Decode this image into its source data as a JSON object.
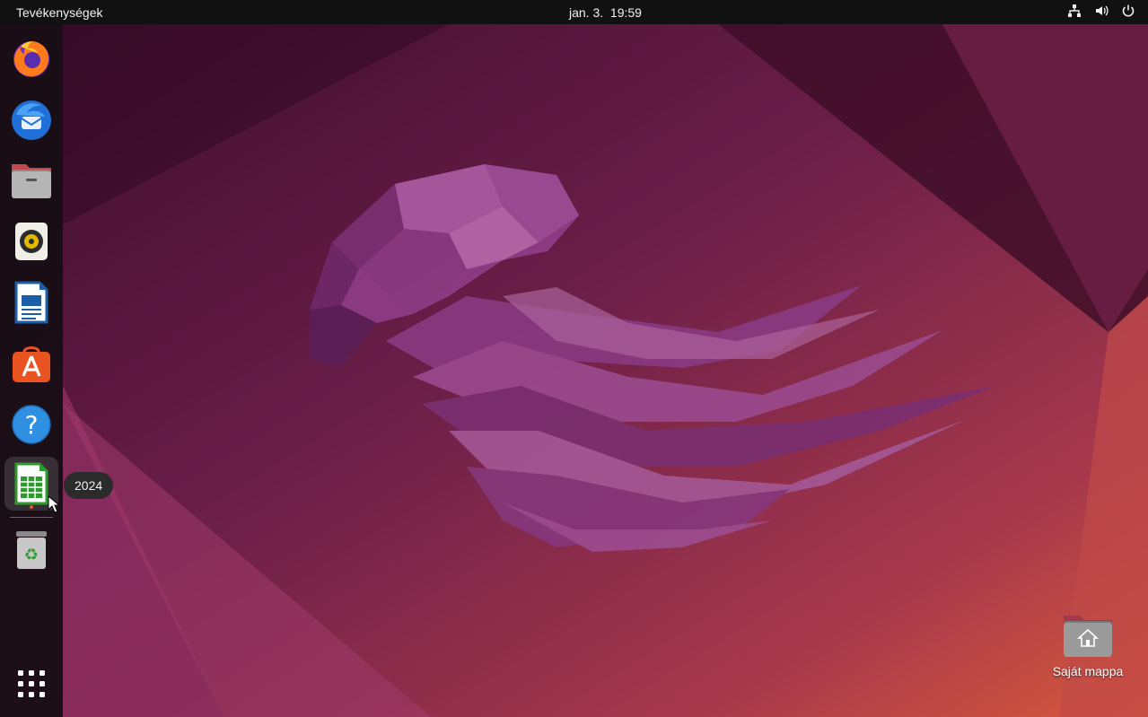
{
  "topbar": {
    "activities_label": "Tevékenységek",
    "clock": "jan. 3.  19:59",
    "tray_icons": [
      "network-icon",
      "volume-icon",
      "power-icon"
    ]
  },
  "dock": {
    "items": [
      {
        "name": "Firefox",
        "icon": "firefox-icon"
      },
      {
        "name": "Thunderbird",
        "icon": "thunderbird-icon"
      },
      {
        "name": "Files",
        "icon": "files-icon"
      },
      {
        "name": "Rhythmbox",
        "icon": "rhythmbox-icon"
      },
      {
        "name": "LibreOffice Writer",
        "icon": "writer-icon"
      },
      {
        "name": "Ubuntu Software",
        "icon": "software-icon"
      },
      {
        "name": "Help",
        "icon": "help-icon"
      },
      {
        "name": "LibreOffice Calc",
        "icon": "calc-icon",
        "active": true
      },
      {
        "name": "Trash",
        "icon": "trash-icon"
      }
    ],
    "show_apps_icon": "grid-icon",
    "tooltip": "2024"
  },
  "desktop": {
    "home_folder_label": "Saját mappa"
  },
  "colors": {
    "topbar": "#111111",
    "accent": "#e95420",
    "dock": "#160e14"
  }
}
